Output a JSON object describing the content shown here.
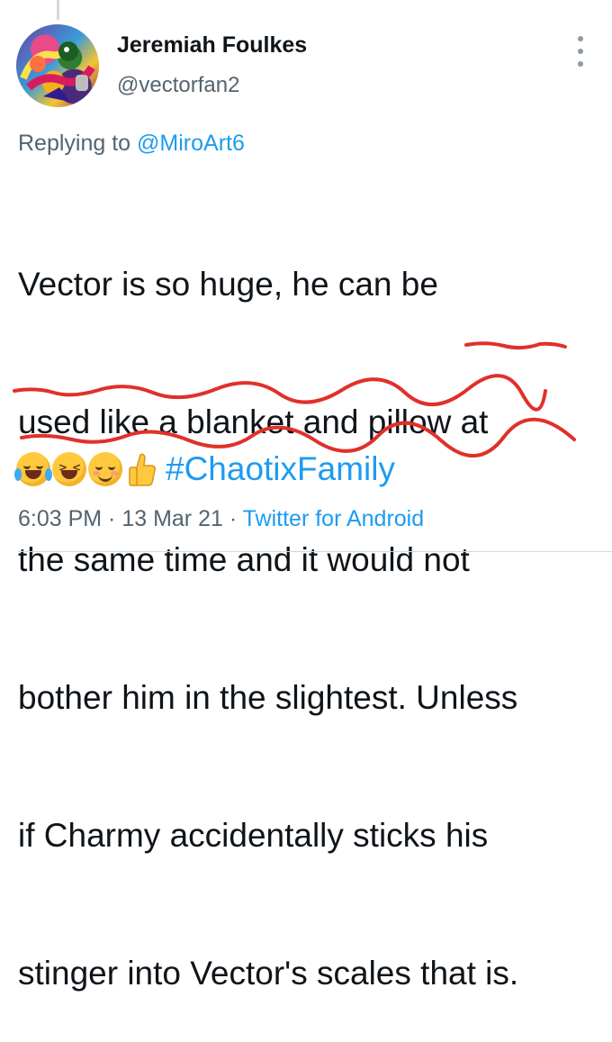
{
  "tweet": {
    "author": {
      "display_name": "Jeremiah Foulkes",
      "handle": "@vectorfan2",
      "avatar_icon": "avatar-image"
    },
    "reply_to": {
      "prefix": "Replying to",
      "mention": "@MiroArt6"
    },
    "text_lines": [
      "Vector is so huge, he can be",
      "used like a blanket and pillow at",
      "the same time and it would not",
      "bother him in the slightest. Unless",
      "if Charmy accidentally sticks his",
      "stinger into Vector's scales that is."
    ],
    "emojis": [
      "face-with-tears-of-joy",
      "grinning-squinting-face",
      "relieved-face",
      "thumbs-up"
    ],
    "hashtag": "#ChaotixFamily",
    "timestamp": "6:03 PM · 13 Mar 21 ·",
    "source": "Twitter for Android"
  },
  "colors": {
    "accent": "#1d9bf0",
    "secondary_text": "#536471",
    "scribble": "#e0302a"
  },
  "icons": {
    "more": "more-vertical-icon"
  }
}
